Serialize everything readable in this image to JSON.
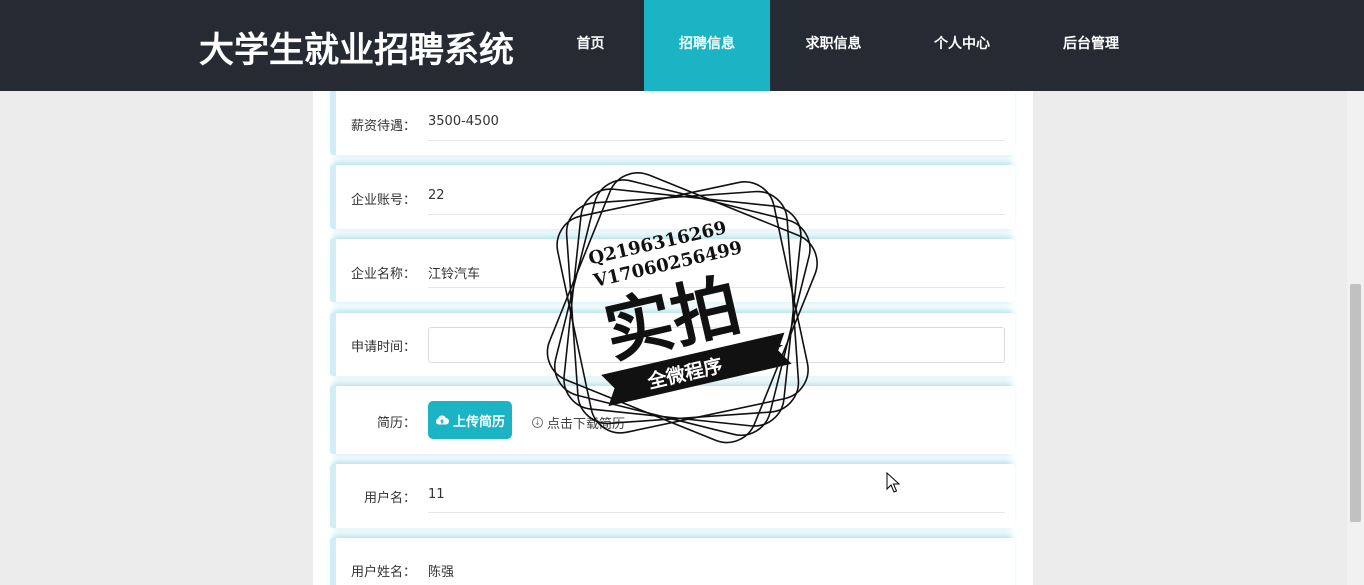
{
  "header": {
    "title": "大学生就业招聘系统",
    "nav": [
      {
        "label": "首页",
        "active": false
      },
      {
        "label": "招聘信息",
        "active": true
      },
      {
        "label": "求职信息",
        "active": false
      },
      {
        "label": "个人中心",
        "active": false
      },
      {
        "label": "后台管理",
        "active": false
      }
    ]
  },
  "form": {
    "salary": {
      "label": "薪资待遇：",
      "value": "3500-4500"
    },
    "company_account": {
      "label": "企业账号：",
      "value": "22"
    },
    "company_name": {
      "label": "企业名称：",
      "value": "江铃汽车"
    },
    "apply_time": {
      "label": "申请时间：",
      "value": ""
    },
    "resume": {
      "label": "简历：",
      "upload_label": "上传简历",
      "download_label": "点击下载简历"
    },
    "username": {
      "label": "用户名：",
      "value": "11"
    },
    "real_name": {
      "label": "用户姓名：",
      "value": "陈强"
    }
  },
  "watermark": {
    "line1": "Q2196316269",
    "line2": "V17060256499",
    "main": "实拍",
    "ribbon": "全微程序"
  },
  "colors": {
    "accent": "#1bb4c4",
    "header_bg": "#262a33",
    "page_bg": "#ececec"
  },
  "icons": {
    "upload": "cloud-upload-icon",
    "download": "download-circle-icon"
  }
}
